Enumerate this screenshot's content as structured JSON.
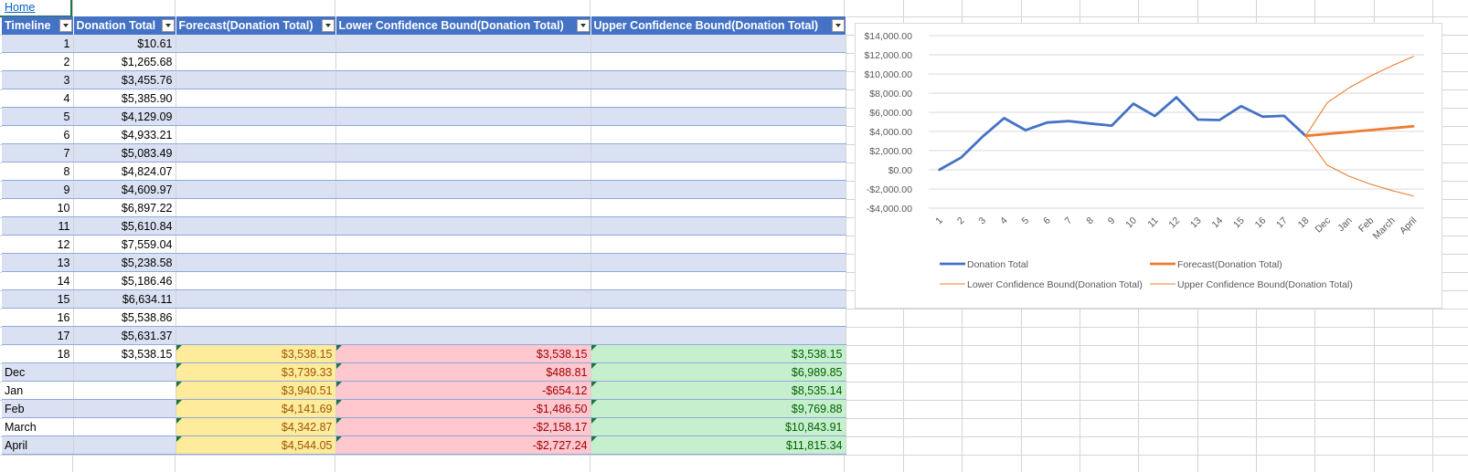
{
  "home_link": "Home",
  "table": {
    "headers": [
      "Timeline",
      "Donation Total",
      "Forecast(Donation Total)",
      "Lower Confidence Bound(Donation Total)",
      "Upper Confidence Bound(Donation Total)"
    ],
    "rows": [
      [
        "1",
        "$10.61",
        "",
        "",
        ""
      ],
      [
        "2",
        "$1,265.68",
        "",
        "",
        ""
      ],
      [
        "3",
        "$3,455.76",
        "",
        "",
        ""
      ],
      [
        "4",
        "$5,385.90",
        "",
        "",
        ""
      ],
      [
        "5",
        "$4,129.09",
        "",
        "",
        ""
      ],
      [
        "6",
        "$4,933.21",
        "",
        "",
        ""
      ],
      [
        "7",
        "$5,083.49",
        "",
        "",
        ""
      ],
      [
        "8",
        "$4,824.07",
        "",
        "",
        ""
      ],
      [
        "9",
        "$4,609.97",
        "",
        "",
        ""
      ],
      [
        "10",
        "$6,897.22",
        "",
        "",
        ""
      ],
      [
        "11",
        "$5,610.84",
        "",
        "",
        ""
      ],
      [
        "12",
        "$7,559.04",
        "",
        "",
        ""
      ],
      [
        "13",
        "$5,238.58",
        "",
        "",
        ""
      ],
      [
        "14",
        "$5,186.46",
        "",
        "",
        ""
      ],
      [
        "15",
        "$6,634.11",
        "",
        "",
        ""
      ],
      [
        "16",
        "$5,538.86",
        "",
        "",
        ""
      ],
      [
        "17",
        "$5,631.37",
        "",
        "",
        ""
      ],
      [
        "18",
        "$3,538.15",
        "$3,538.15",
        "$3,538.15",
        "$3,538.15"
      ],
      [
        "Dec",
        "",
        "$3,739.33",
        "$488.81",
        "$6,989.85"
      ],
      [
        "Jan",
        "",
        "$3,940.51",
        "-$654.12",
        "$8,535.14"
      ],
      [
        "Feb",
        "",
        "$4,141.69",
        "-$1,486.50",
        "$9,769.88"
      ],
      [
        "March",
        "",
        "$4,342.87",
        "-$2,158.17",
        "$10,843.91"
      ],
      [
        "April",
        "",
        "$4,544.05",
        "-$2,727.24",
        "$11,815.34"
      ]
    ]
  },
  "chart_data": {
    "type": "line",
    "categories": [
      "1",
      "2",
      "3",
      "4",
      "5",
      "6",
      "7",
      "8",
      "9",
      "10",
      "11",
      "12",
      "13",
      "14",
      "15",
      "16",
      "17",
      "18",
      "Dec",
      "Jan",
      "Feb",
      "March",
      "April"
    ],
    "y_ticks": [
      "$14,000.00",
      "$12,000.00",
      "$10,000.00",
      "$8,000.00",
      "$6,000.00",
      "$4,000.00",
      "$2,000.00",
      "$0.00",
      "-$2,000.00",
      "-$4,000.00"
    ],
    "ylim": [
      -4000,
      14000
    ],
    "grid": true,
    "legend_position": "bottom",
    "series": [
      {
        "name": "Donation Total",
        "color": "#4472c4",
        "width": "thick",
        "values": [
          10.61,
          1265.68,
          3455.76,
          5385.9,
          4129.09,
          4933.21,
          5083.49,
          4824.07,
          4609.97,
          6897.22,
          5610.84,
          7559.04,
          5238.58,
          5186.46,
          6634.11,
          5538.86,
          5631.37,
          3538.15,
          null,
          null,
          null,
          null,
          null
        ]
      },
      {
        "name": "Forecast(Donation Total)",
        "color": "#ed7d31",
        "width": "thick",
        "values": [
          null,
          null,
          null,
          null,
          null,
          null,
          null,
          null,
          null,
          null,
          null,
          null,
          null,
          null,
          null,
          null,
          null,
          3538.15,
          3739.33,
          3940.51,
          4141.69,
          4342.87,
          4544.05
        ]
      },
      {
        "name": "Lower Confidence Bound(Donation Total)",
        "color": "#ed7d31",
        "width": "thin",
        "values": [
          null,
          null,
          null,
          null,
          null,
          null,
          null,
          null,
          null,
          null,
          null,
          null,
          null,
          null,
          null,
          null,
          null,
          3538.15,
          488.81,
          -654.12,
          -1486.5,
          -2158.17,
          -2727.24
        ]
      },
      {
        "name": "Upper Confidence Bound(Donation Total)",
        "color": "#ed7d31",
        "width": "thin",
        "values": [
          null,
          null,
          null,
          null,
          null,
          null,
          null,
          null,
          null,
          null,
          null,
          null,
          null,
          null,
          null,
          null,
          null,
          3538.15,
          6989.85,
          8535.14,
          9769.88,
          10843.91,
          11815.34
        ]
      }
    ]
  }
}
